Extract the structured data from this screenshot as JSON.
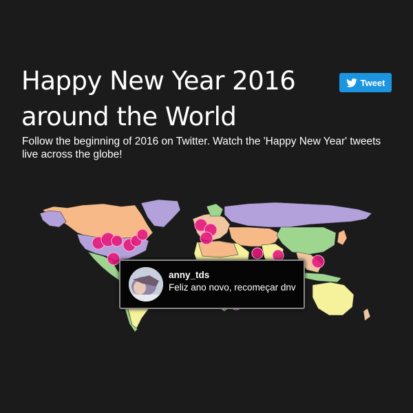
{
  "header": {
    "title_line1": "Happy New Year 2016",
    "title_line2": "around the World",
    "subtitle": "Follow the beginning of 2016 on Twitter. Watch the 'Happy New Year' tweets live across the globe!"
  },
  "tweet_button": {
    "label": "Tweet",
    "icon": "twitter-bird-icon",
    "color": "#1b95e0"
  },
  "map": {
    "ocean_color": "#1b1b1b",
    "land_colors": [
      "#b3a1dc",
      "#f7b987",
      "#9ed690",
      "#f5f29b",
      "#f0c6a0"
    ],
    "marker_color": "#e2197c"
  },
  "tooltip": {
    "user": "anny_tds",
    "text": "Feliz ano novo, recomeçar dnv"
  }
}
